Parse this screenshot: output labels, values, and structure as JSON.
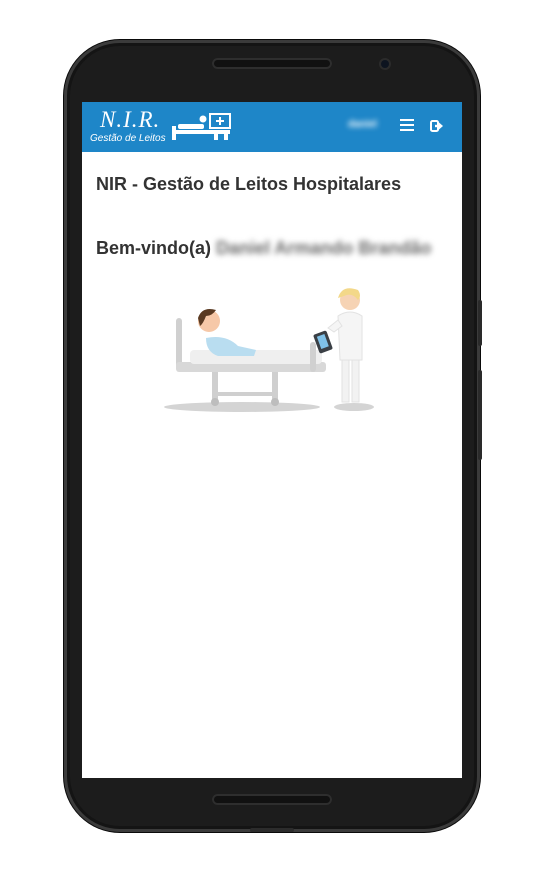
{
  "app": {
    "logo_title": "N.I.R.",
    "logo_subtitle": "Gestão de Leitos"
  },
  "header": {
    "user_name": "daniel",
    "menu_icon": "hamburger-menu-icon",
    "logout_icon": "logout-icon"
  },
  "main": {
    "title": "NIR - Gestão de Leitos Hospitalares",
    "welcome_label": "Bem-vindo(a)",
    "welcome_name": "Daniel Armando Brandão"
  },
  "colors": {
    "appbar": "#1e86c8",
    "text": "#333333",
    "device": "#1c1c1c"
  }
}
